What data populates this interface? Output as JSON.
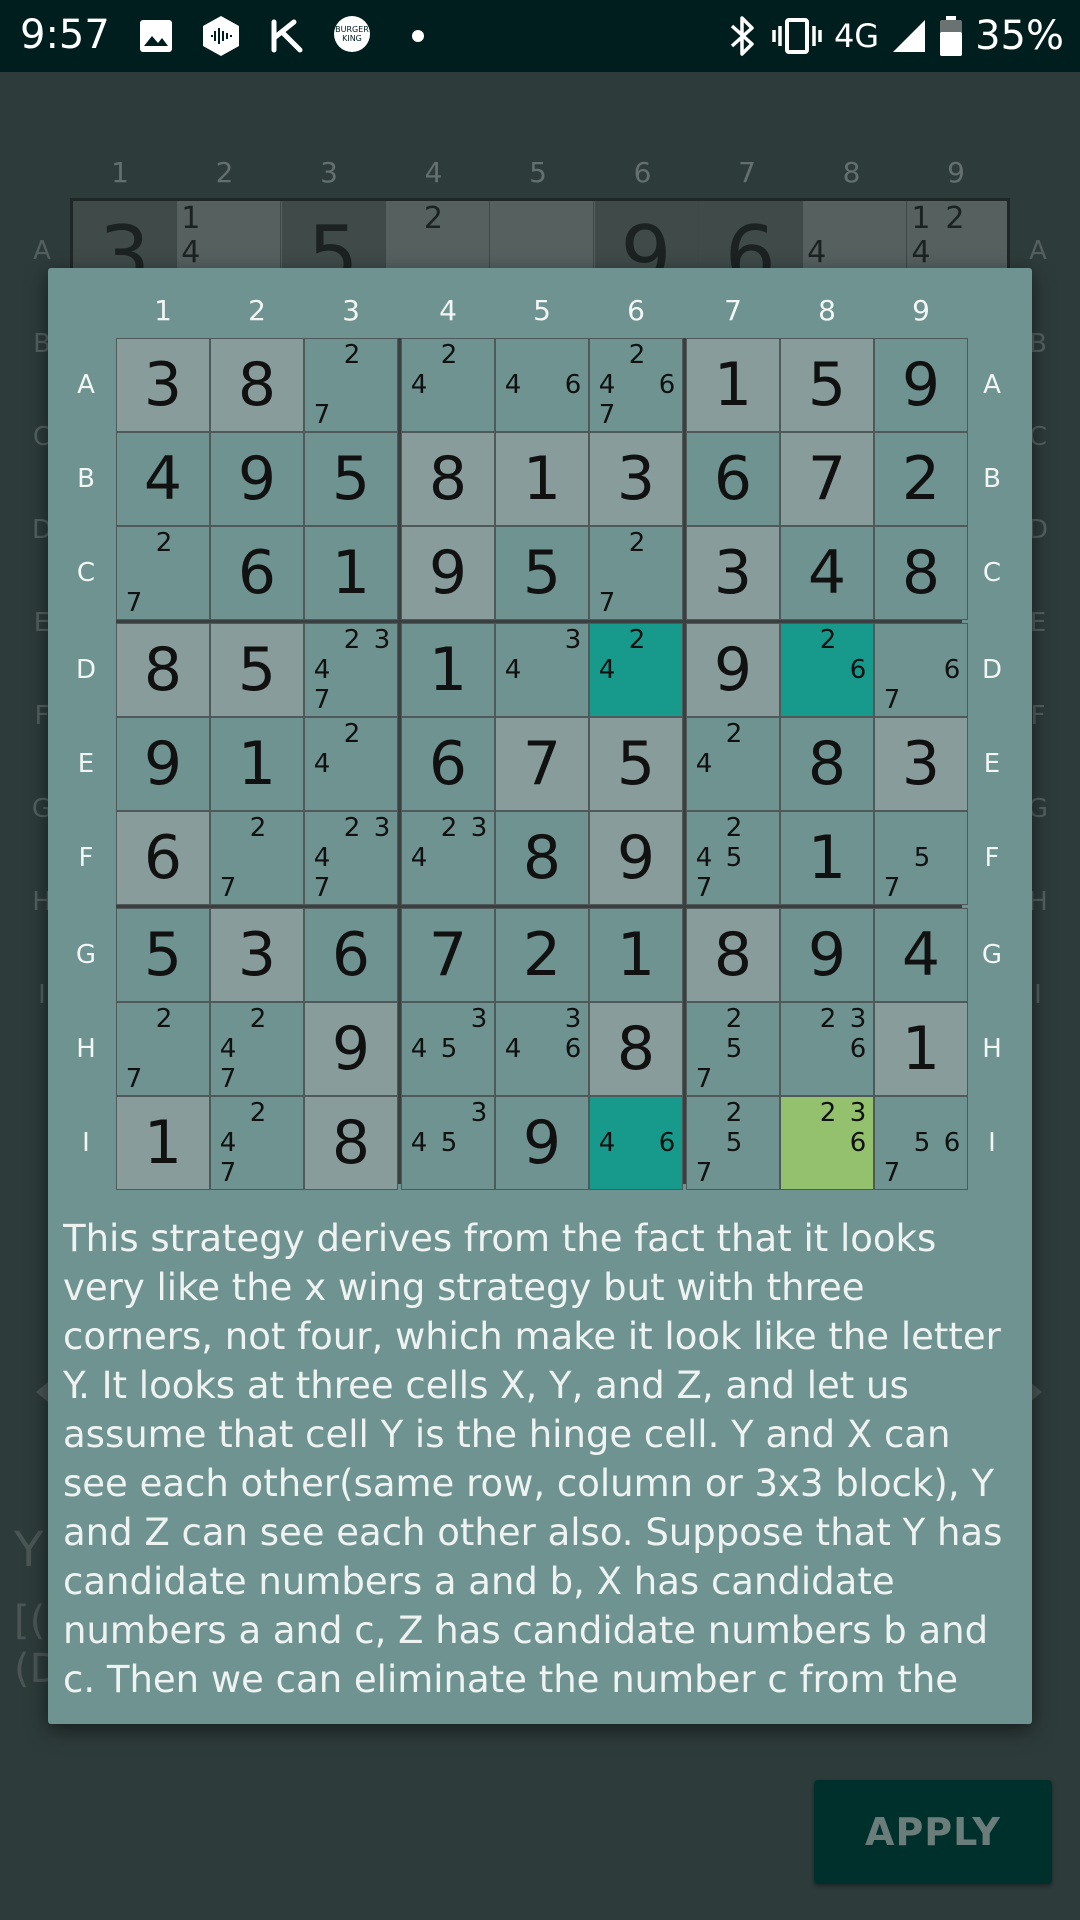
{
  "status_bar": {
    "time": "9:57",
    "network": "4G",
    "battery": "35%",
    "icons": [
      "image-icon",
      "soundhound-icon",
      "k-icon",
      "burger-king-icon",
      "dot-icon",
      "bluetooth-icon",
      "vibrate-icon",
      "signal-icon",
      "battery-icon"
    ]
  },
  "background": {
    "col_labels": [
      "1",
      "2",
      "3",
      "4",
      "5",
      "6",
      "7",
      "8",
      "9"
    ],
    "row_labels": [
      "A",
      "B",
      "C",
      "D",
      "E",
      "F",
      "G",
      "H",
      "I"
    ],
    "strip_values": [
      "3",
      "",
      "5",
      "",
      "",
      "9",
      "6",
      "",
      ""
    ],
    "strip_cands": [
      [
        "1",
        "4"
      ],
      [
        "2"
      ],
      [
        "4"
      ],
      [
        "1",
        "2",
        "4"
      ]
    ],
    "heading_fragment": "Y",
    "line1_fragment": "[(",
    "line2_fragment": "(D",
    "apply_label": "APPLY"
  },
  "dialog": {
    "col_labels": [
      "1",
      "2",
      "3",
      "4",
      "5",
      "6",
      "7",
      "8",
      "9"
    ],
    "row_labels": [
      "A",
      "B",
      "C",
      "D",
      "E",
      "F",
      "G",
      "H",
      "I"
    ],
    "description": "This strategy derives from the fact that it looks very like the x wing strategy but with three corners, not four, which make it look like the letter Y. It looks at three cells X, Y, and Z, and let us assume that cell Y is the hinge cell. Y and X can see each other(same row, column or 3x3 block), Y and Z can see each other also. Suppose that Y has candidate numbers a and b, X has candidate numbers a and c, Z has candidate numbers b and c. Then we can eliminate the number c from the cells which can see both X"
  },
  "colors": {
    "dialog_bg": "#6e9390",
    "given_cell": "#889c9b",
    "highlight_teal": "#179a8b",
    "highlight_green": "#94c16e",
    "status_bar": "#001e1d"
  },
  "grid": [
    [
      [
        "3",
        1,
        []
      ],
      [
        "8",
        1,
        []
      ],
      [
        "",
        0,
        [
          "2",
          "7"
        ]
      ],
      [
        "",
        0,
        [
          "2",
          "4"
        ]
      ],
      [
        "",
        0,
        [
          "4",
          "6"
        ]
      ],
      [
        "",
        0,
        [
          "2",
          "4",
          "6",
          "7"
        ]
      ],
      [
        "1",
        1,
        []
      ],
      [
        "5",
        1,
        []
      ],
      [
        "9",
        0,
        []
      ]
    ],
    [
      [
        "4",
        0,
        []
      ],
      [
        "9",
        0,
        []
      ],
      [
        "5",
        0,
        []
      ],
      [
        "8",
        1,
        []
      ],
      [
        "1",
        1,
        []
      ],
      [
        "3",
        1,
        []
      ],
      [
        "6",
        0,
        []
      ],
      [
        "7",
        1,
        []
      ],
      [
        "2",
        0,
        []
      ]
    ],
    [
      [
        "",
        0,
        [
          "2",
          "7"
        ]
      ],
      [
        "6",
        0,
        []
      ],
      [
        "1",
        0,
        []
      ],
      [
        "9",
        1,
        []
      ],
      [
        "5",
        0,
        []
      ],
      [
        "",
        0,
        [
          "2",
          "7"
        ]
      ],
      [
        "3",
        1,
        []
      ],
      [
        "4",
        0,
        []
      ],
      [
        "8",
        0,
        []
      ]
    ],
    [
      [
        "8",
        1,
        []
      ],
      [
        "5",
        1,
        []
      ],
      [
        "",
        0,
        [
          "2",
          "3",
          "4",
          "7"
        ]
      ],
      [
        "1",
        0,
        []
      ],
      [
        "",
        0,
        [
          "3",
          "4"
        ]
      ],
      [
        "",
        2,
        [
          "2",
          "4"
        ]
      ],
      [
        "9",
        1,
        []
      ],
      [
        "",
        2,
        [
          "2",
          "6"
        ]
      ],
      [
        "",
        0,
        [
          "6",
          "7"
        ]
      ]
    ],
    [
      [
        "9",
        0,
        []
      ],
      [
        "1",
        0,
        []
      ],
      [
        "",
        0,
        [
          "2",
          "4"
        ]
      ],
      [
        "6",
        0,
        []
      ],
      [
        "7",
        1,
        []
      ],
      [
        "5",
        1,
        []
      ],
      [
        "",
        0,
        [
          "2",
          "4"
        ]
      ],
      [
        "8",
        0,
        []
      ],
      [
        "3",
        1,
        []
      ]
    ],
    [
      [
        "6",
        1,
        []
      ],
      [
        "",
        0,
        [
          "2",
          "7"
        ]
      ],
      [
        "",
        0,
        [
          "2",
          "3",
          "4",
          "7"
        ]
      ],
      [
        "",
        0,
        [
          "2",
          "3",
          "4"
        ]
      ],
      [
        "8",
        0,
        []
      ],
      [
        "9",
        1,
        []
      ],
      [
        "",
        0,
        [
          "2",
          "4",
          "5",
          "7"
        ]
      ],
      [
        "1",
        0,
        []
      ],
      [
        "",
        0,
        [
          "5",
          "7"
        ]
      ]
    ],
    [
      [
        "5",
        0,
        []
      ],
      [
        "3",
        1,
        []
      ],
      [
        "6",
        0,
        []
      ],
      [
        "7",
        0,
        []
      ],
      [
        "2",
        0,
        []
      ],
      [
        "1",
        0,
        []
      ],
      [
        "8",
        1,
        []
      ],
      [
        "9",
        0,
        []
      ],
      [
        "4",
        0,
        []
      ]
    ],
    [
      [
        "",
        0,
        [
          "2",
          "7"
        ]
      ],
      [
        "",
        0,
        [
          "2",
          "4",
          "7"
        ]
      ],
      [
        "9",
        1,
        []
      ],
      [
        "",
        0,
        [
          "3",
          "4",
          "5"
        ]
      ],
      [
        "",
        0,
        [
          "3",
          "4",
          "6"
        ]
      ],
      [
        "8",
        1,
        []
      ],
      [
        "",
        0,
        [
          "2",
          "5",
          "7"
        ]
      ],
      [
        "",
        0,
        [
          "2",
          "3",
          "6"
        ]
      ],
      [
        "1",
        1,
        []
      ]
    ],
    [
      [
        "1",
        1,
        []
      ],
      [
        "",
        0,
        [
          "2",
          "4",
          "7"
        ]
      ],
      [
        "8",
        1,
        []
      ],
      [
        "",
        0,
        [
          "3",
          "4",
          "5"
        ]
      ],
      [
        "9",
        0,
        []
      ],
      [
        "",
        2,
        [
          "4",
          "6"
        ]
      ],
      [
        "",
        0,
        [
          "2",
          "5",
          "7"
        ]
      ],
      [
        "",
        3,
        [
          "2",
          "3",
          "6"
        ]
      ],
      [
        "",
        0,
        [
          "5",
          "6",
          "7"
        ]
      ]
    ]
  ]
}
